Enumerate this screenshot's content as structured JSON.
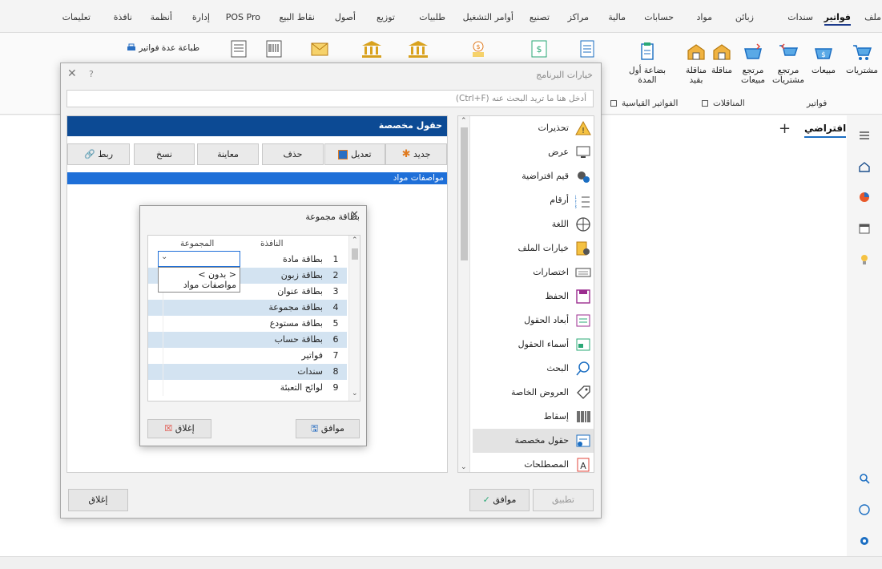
{
  "menubar": {
    "items": [
      "ملف",
      "فواتير",
      "سندات",
      "زبائن",
      "مواد",
      "حسابات",
      "مالية",
      "مراكز",
      "تصنيع",
      "أوامر التشغيل",
      "طلبيات",
      "توزيع",
      "أصول",
      "نقاط البيع",
      "POS Pro",
      "إدارة",
      "أنظمة",
      "نافذة",
      "تعليمات"
    ],
    "active": "فواتير"
  },
  "ribbon": {
    "purchases": "مشتريات",
    "sales": "مبيعات",
    "purchase_return": "مرتجع مشتريات",
    "sales_return": "مرتجع مبيعات",
    "transfer": "مناقلة",
    "transfer_restricted": "مناقلة بقيد",
    "opening_goods": "بضاعة أول المدة",
    "print_multiple": "طباعة عدة فواتير",
    "group_invoices": "فواتير",
    "group_transfers": "المناقلات",
    "group_standard": "الفواتير القياسية"
  },
  "tab": {
    "label": "افتراضي",
    "plus": "+"
  },
  "options_dialog": {
    "title": "خيارات البرنامج",
    "help": "?",
    "close": "✕",
    "search_placeholder": "أدخل هنا ما تريد البحث عنه (Ctrl+F)",
    "options": [
      {
        "label": "تحذيرات",
        "icon": "warning-icon"
      },
      {
        "label": "عرض",
        "icon": "monitor-icon"
      },
      {
        "label": "قيم افتراضية",
        "icon": "gears-icon"
      },
      {
        "label": "أرقام",
        "icon": "numbered-list-icon"
      },
      {
        "label": "اللغة",
        "icon": "globe-icon"
      },
      {
        "label": "خيارات الملف",
        "icon": "file-settings-icon"
      },
      {
        "label": "اختصارات",
        "icon": "keyboard-icon"
      },
      {
        "label": "الحفظ",
        "icon": "save-icon"
      },
      {
        "label": "أبعاد الحقول",
        "icon": "field-size-icon"
      },
      {
        "label": "أسماء الحقول",
        "icon": "field-names-icon"
      },
      {
        "label": "البحث",
        "icon": "search-icon"
      },
      {
        "label": "العروض الخاصة",
        "icon": "tag-icon"
      },
      {
        "label": "إسقاط",
        "icon": "barcode-icon"
      },
      {
        "label": "حقول مخصصة",
        "icon": "custom-fields-icon"
      },
      {
        "label": "المصطلحات",
        "icon": "terms-icon"
      }
    ],
    "selected_option": "حقول مخصصة",
    "panel_title": "حقول مخصصة",
    "toolbar": {
      "new": "جديد",
      "edit": "تعديل",
      "delete": "حذف",
      "preview": "معاينة",
      "copy": "نسخ",
      "link": "ربط"
    },
    "list_item": "مواصفات مواد",
    "close_button": "إغلاق",
    "ok_button": "موافق",
    "apply_button": "تطبيق"
  },
  "group_card_dialog": {
    "title": "بطاقة مجموعة",
    "close": "✕",
    "col_window": "النافذة",
    "col_group": "المجموعة",
    "rows": [
      {
        "num": "1",
        "window": "بطاقة مادة"
      },
      {
        "num": "2",
        "window": "بطاقة زبون"
      },
      {
        "num": "3",
        "window": "بطاقة عنوان"
      },
      {
        "num": "4",
        "window": "بطاقة مجموعة"
      },
      {
        "num": "5",
        "window": "بطاقة مستودع"
      },
      {
        "num": "6",
        "window": "بطاقة حساب"
      },
      {
        "num": "7",
        "window": "فواتير"
      },
      {
        "num": "8",
        "window": "سندات"
      },
      {
        "num": "9",
        "window": "لوائح التعبئة"
      }
    ],
    "dropdown_options": [
      "< بدون >",
      "مواصفات مواد"
    ],
    "ok_button": "موافق",
    "close_button": "إغلاق"
  }
}
